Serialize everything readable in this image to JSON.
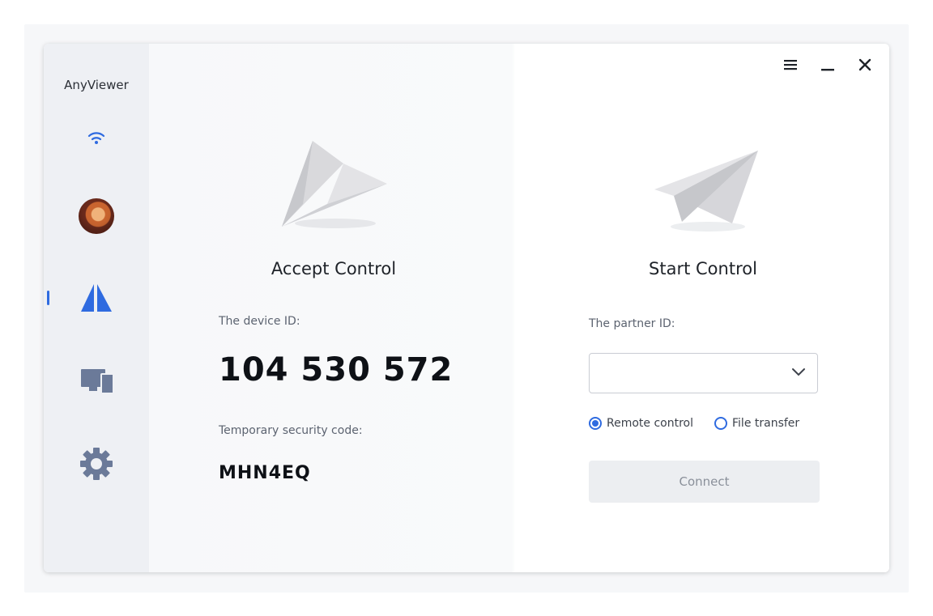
{
  "app": {
    "title": "AnyViewer"
  },
  "sidebar": {
    "items": [
      {
        "icon": "wifi-icon"
      },
      {
        "icon": "avatar"
      },
      {
        "icon": "remote-control-icon",
        "active": true
      },
      {
        "icon": "devices-icon"
      },
      {
        "icon": "gear-icon"
      }
    ]
  },
  "window_controls": [
    "menu-icon",
    "minimize-icon",
    "close-icon"
  ],
  "accept": {
    "heading": "Accept Control",
    "device_id_label": "The device ID:",
    "device_id": "104 530 572",
    "security_label": "Temporary security code:",
    "security_code": "MHN4EQ"
  },
  "start": {
    "heading": "Start Control",
    "partner_label": "The partner ID:",
    "partner_value": "",
    "options": [
      "Remote control",
      "File transfer"
    ],
    "selected_option": "Remote control",
    "connect_label": "Connect"
  },
  "colors": {
    "accent": "#2f6be0",
    "sidebar_bg": "#eef0f4",
    "icon_gray": "#6b7a99"
  }
}
